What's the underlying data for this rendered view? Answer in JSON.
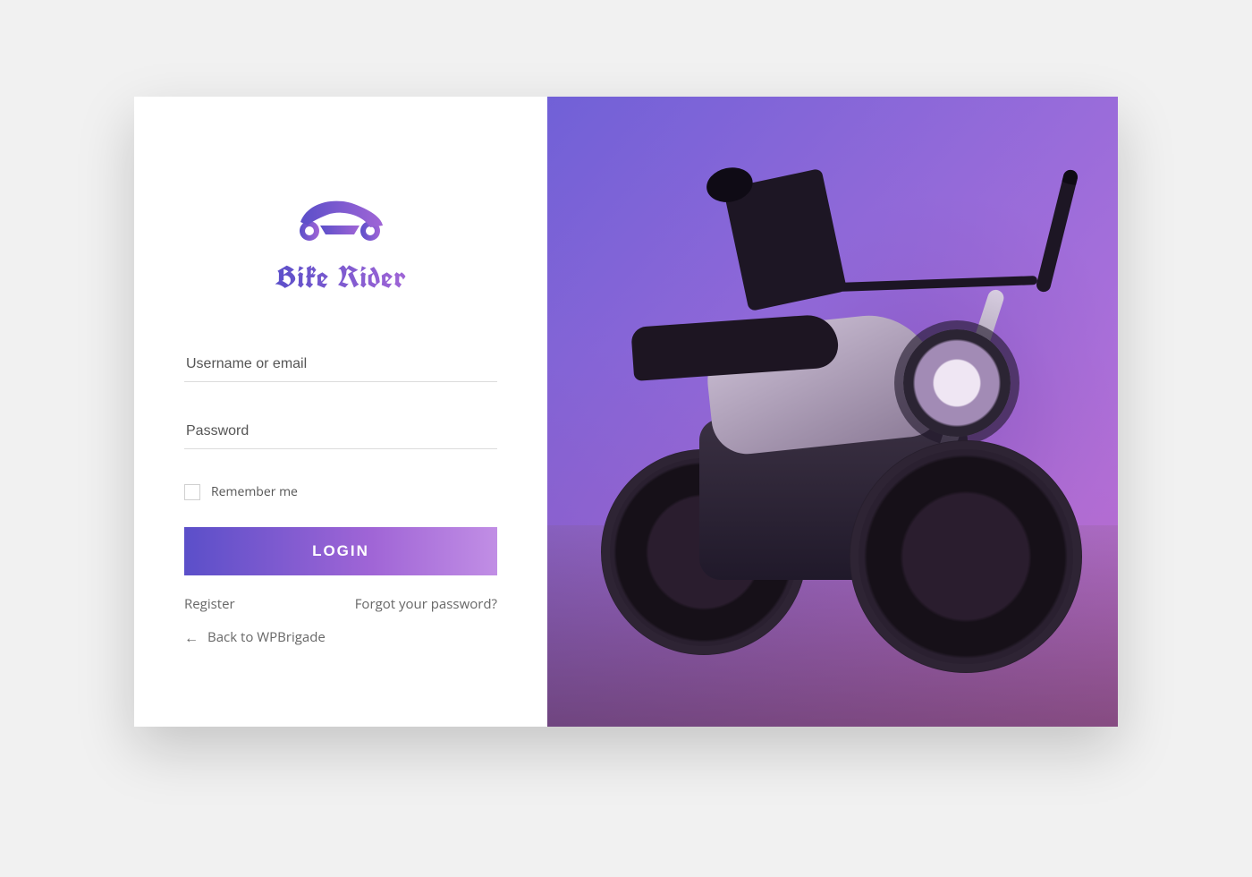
{
  "brand": {
    "name": "Bike Rider"
  },
  "form": {
    "username_placeholder": "Username or email",
    "password_placeholder": "Password",
    "remember_label": "Remember me",
    "submit_label": "LOGIN"
  },
  "links": {
    "register": "Register",
    "forgot": "Forgot your password?",
    "back": "Back to WPBrigade"
  },
  "colors": {
    "gradient_start": "#5b4fc9",
    "gradient_end": "#c18ee5"
  }
}
